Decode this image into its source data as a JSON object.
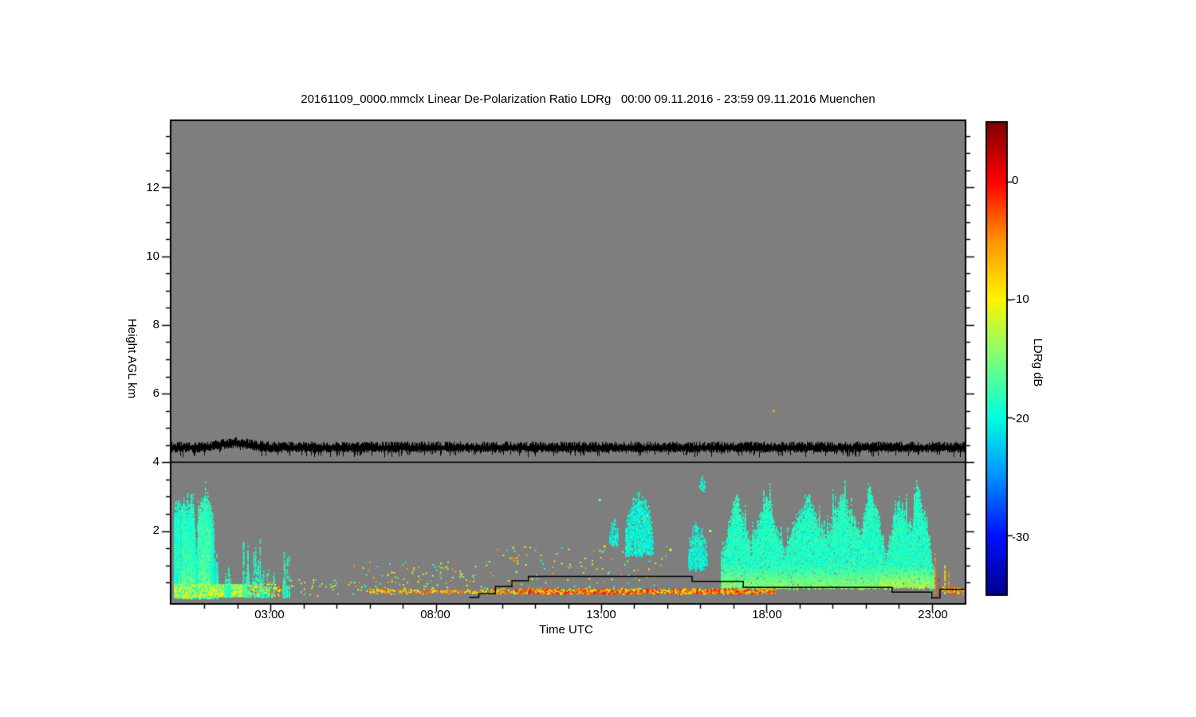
{
  "figure": {
    "title": "20161109_0000.mmclx Linear De-Polarization Ratio LDRg   00:00 09.11.2016 - 23:59 09.11.2016 Muenchen",
    "x_axis": {
      "label": "Time UTC",
      "tick_labels": [
        "03:00",
        "08:00",
        "13:00",
        "18:00",
        "23:00"
      ]
    },
    "y_axis": {
      "label": "Height AGL km",
      "tick_labels": [
        "12",
        "10",
        "8",
        "6",
        "4",
        "2"
      ]
    },
    "colorbar": {
      "label": "LDRg dB",
      "tick_labels": [
        "0",
        "-10",
        "-20",
        "-30"
      ]
    }
  },
  "chart_data": {
    "type": "heatmap",
    "title": "20161109_0000.mmclx Linear De-Polarization Ratio LDRg   00:00 09.11.2016 - 23:59 09.11.2016 Muenchen",
    "xlabel": "Time UTC",
    "ylabel": "Height AGL km",
    "x_range_hours": [
      0,
      24
    ],
    "x_major_tick_hours": [
      3,
      8,
      13,
      18,
      23
    ],
    "x_major_tick_labels": [
      "03:00",
      "08:00",
      "13:00",
      "18:00",
      "23:00"
    ],
    "x_minor_tick_step_hours": 1,
    "y_range_km": [
      0,
      13.95
    ],
    "y_major_ticks_km": [
      2,
      4,
      6,
      8,
      10,
      12
    ],
    "y_minor_tick_step_km": 0.5,
    "background_color": "#7e7e7e",
    "colorbar": {
      "label": "LDRg dB",
      "tick_values_db": [
        0,
        -10,
        -20,
        -30
      ],
      "max_db": 5,
      "min_db": -35,
      "colormap": "jet"
    },
    "jet_stops": [
      [
        0,
        128,
        0,
        0
      ],
      [
        0.125,
        255,
        0,
        0
      ],
      [
        0.25,
        255,
        148,
        0
      ],
      [
        0.375,
        255,
        244,
        0
      ],
      [
        0.5,
        124,
        255,
        121
      ],
      [
        0.625,
        0,
        255,
        222
      ],
      [
        0.75,
        0,
        145,
        255
      ],
      [
        0.875,
        0,
        16,
        255
      ],
      [
        1,
        0,
        0,
        143
      ]
    ],
    "noise_band": {
      "center_km": 4.42,
      "hump_t": 1.9,
      "hump_amp_km": 0.13,
      "hump_sigma": 0.6
    },
    "separator_line_km": 4.0,
    "cloud_base_step_line_t_km": [
      [
        9.0,
        0.07
      ],
      [
        9.3,
        0.07
      ],
      [
        9.3,
        0.17
      ],
      [
        9.8,
        0.17
      ],
      [
        9.8,
        0.38
      ],
      [
        10.3,
        0.38
      ],
      [
        10.3,
        0.55
      ],
      [
        10.8,
        0.55
      ],
      [
        10.8,
        0.68
      ],
      [
        15.75,
        0.68
      ],
      [
        15.75,
        0.53
      ],
      [
        17.3,
        0.53
      ],
      [
        17.3,
        0.36
      ],
      [
        21.8,
        0.36
      ],
      [
        21.8,
        0.22
      ],
      [
        23.0,
        0.22
      ],
      [
        23.0,
        0.05
      ],
      [
        23.25,
        0.05
      ],
      [
        23.25,
        0.3
      ],
      [
        24.0,
        0.3
      ]
    ],
    "echoes": {
      "early_cluster": {
        "t0": 0.05,
        "t1": 1.42,
        "base_km": 0.05,
        "top_profile": [
          [
            0.05,
            2.6
          ],
          [
            0.2,
            2.9
          ],
          [
            0.45,
            2.7
          ],
          [
            0.6,
            3.0
          ],
          [
            0.68,
            2.5
          ],
          [
            0.74,
            1.3
          ],
          [
            0.8,
            2.7
          ],
          [
            0.95,
            3.0
          ],
          [
            1.05,
            3.05
          ],
          [
            1.15,
            2.8
          ],
          [
            1.25,
            2.3
          ],
          [
            1.32,
            1.5
          ],
          [
            1.42,
            0.85
          ]
        ],
        "core_windows": [
          [
            0.22,
            0.7,
            7,
            0.9
          ],
          [
            0.8,
            1.18,
            6.5,
            1.6
          ]
        ]
      },
      "early_low_band": {
        "t0": 0.05,
        "t1": 2.32,
        "k0": 0.1,
        "k1": 0.45
      },
      "spike_groups": [
        {
          "t0": 1.6,
          "t1": 1.8,
          "hmax": 1.0,
          "n": 14
        },
        {
          "t0": 2.15,
          "t1": 2.7,
          "hmax": 1.8,
          "n": 42
        },
        {
          "t0": 2.7,
          "t1": 3.12,
          "hmax": 0.95,
          "n": 26
        },
        {
          "t0": 3.35,
          "t1": 3.58,
          "hmax": 1.45,
          "n": 14
        }
      ],
      "speckle_fields": [
        {
          "n": 1100,
          "t0": 10.4,
          "t1": 18.25,
          "km_center": 0.235,
          "km_sd": 0.045,
          "dbs": [
            -2,
            -5,
            -8,
            -1,
            -12
          ]
        },
        {
          "n": 260,
          "t0": 5.9,
          "t1": 10.4,
          "km_center": 0.24,
          "km_sd": 0.05,
          "dbs": [
            -4,
            -8,
            -12
          ]
        },
        {
          "n": 90,
          "t0": 5.5,
          "t1": 9.5,
          "k0": 0.3,
          "k1": 1.1,
          "dbs": [
            -6,
            -10,
            -14,
            -20
          ]
        },
        {
          "n": 110,
          "t0": 9.5,
          "t1": 15.1,
          "k0": 0.3,
          "k1": 1.55,
          "dbs": [
            -6,
            -10,
            -20,
            -14
          ]
        },
        {
          "n": 35,
          "t0": 3.6,
          "t1": 5.9,
          "k0": 0.1,
          "k1": 0.6,
          "dbs": [
            -10,
            -16,
            -20
          ]
        },
        {
          "n": 60,
          "t0": 2.32,
          "t1": 3.3,
          "k0": 0.1,
          "k1": 0.45,
          "dbs": [
            -12,
            -15,
            -10
          ]
        },
        {
          "n": 26,
          "t0": 2.3,
          "t1": 3.35,
          "k0": 0.08,
          "k1": 0.5,
          "dbs": [
            -3,
            -6
          ]
        },
        {
          "n": 45,
          "t0": 23.3,
          "t1": 24,
          "km_center": 0.25,
          "km_sd": 0.06,
          "dbs": [
            -3,
            -6,
            -10
          ]
        }
      ],
      "mid_blobs": [
        {
          "t0": 13.22,
          "t1": 13.5,
          "k0": 1.55,
          "k1": 2.3
        },
        {
          "t0": 13.72,
          "t1": 14.55,
          "k0": 1.25,
          "k1": 3.05
        },
        {
          "t0": 15.62,
          "t1": 16.2,
          "k0": 0.85,
          "k1": 2.15
        },
        {
          "t0": 15.95,
          "t1": 16.12,
          "k0": 3.15,
          "k1": 3.55
        }
      ],
      "main_mass": {
        "t0": 16.6,
        "t1": 23.05,
        "base_km": 0.32,
        "low_layer_top_km": 1.05,
        "bright_after_t": 21.4,
        "top_profile": [
          [
            16.6,
            0.7
          ],
          [
            16.75,
            1.8
          ],
          [
            16.9,
            2.5
          ],
          [
            17.1,
            3.05
          ],
          [
            17.35,
            2.2
          ],
          [
            17.5,
            1.6
          ],
          [
            17.8,
            2.6
          ],
          [
            18.05,
            2.95
          ],
          [
            18.3,
            2.0
          ],
          [
            18.55,
            1.55
          ],
          [
            18.8,
            2.2
          ],
          [
            19.0,
            2.6
          ],
          [
            19.3,
            3.0
          ],
          [
            19.55,
            2.3
          ],
          [
            19.8,
            1.9
          ],
          [
            20.05,
            2.6
          ],
          [
            20.3,
            3.1
          ],
          [
            20.6,
            2.4
          ],
          [
            20.85,
            2.0
          ],
          [
            21.1,
            3.25
          ],
          [
            21.35,
            2.6
          ],
          [
            21.6,
            1.3
          ],
          [
            21.8,
            2.2
          ],
          [
            22.0,
            2.9
          ],
          [
            22.2,
            2.4
          ],
          [
            22.4,
            2.2
          ],
          [
            22.55,
            3.55
          ],
          [
            22.7,
            2.8
          ],
          [
            22.85,
            2.3
          ],
          [
            23.0,
            1.0
          ]
        ]
      },
      "streaks": [
        [
          22.95,
          0.1,
          1.3,
          -20
        ],
        [
          23.08,
          0.15,
          1.35,
          -6
        ],
        [
          23.2,
          0.1,
          0.7,
          -3
        ],
        [
          23.38,
          0.2,
          1.0,
          -10
        ],
        [
          23.5,
          0.25,
          0.8,
          -6
        ],
        [
          23.62,
          0.1,
          0.5,
          -4
        ]
      ],
      "isolated_dots": [
        [
          18.22,
          5.5,
          -6
        ],
        [
          12.96,
          2.9,
          -16
        ],
        [
          14.4,
          2.45,
          -16
        ],
        [
          13.1,
          1.55,
          -8
        ],
        [
          15.1,
          1.45,
          -10
        ],
        [
          16.3,
          2.0,
          -14
        ]
      ]
    }
  }
}
